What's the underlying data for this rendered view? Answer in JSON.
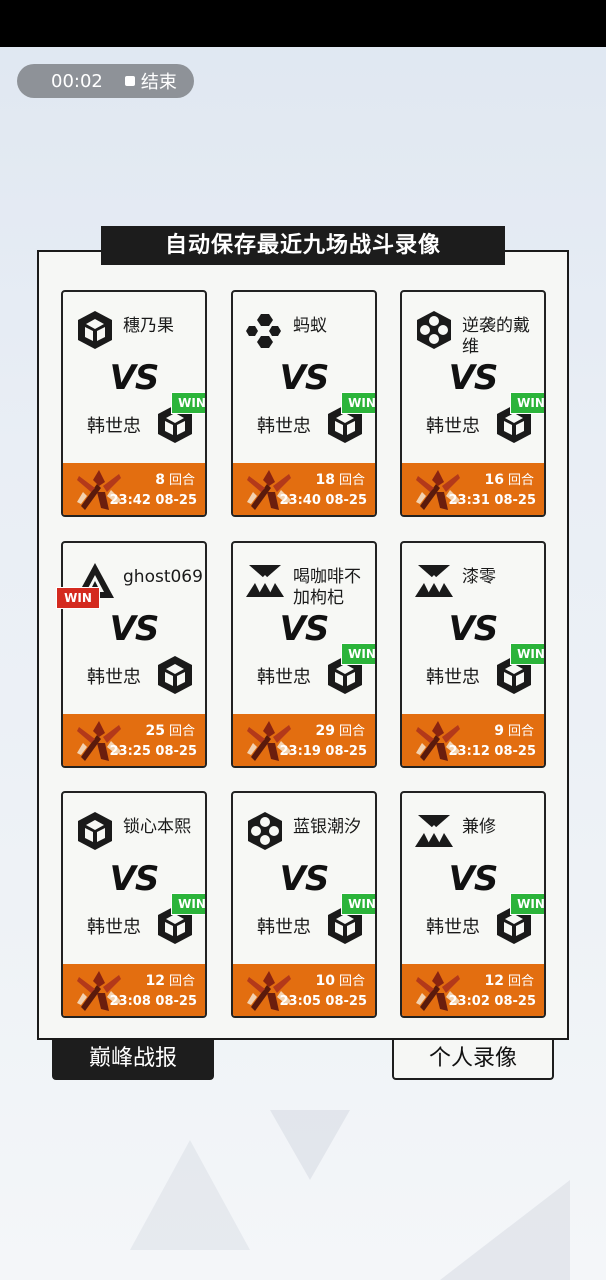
{
  "status_bar": {
    "timer": "00:02",
    "stop_label": "结束"
  },
  "panel": {
    "title": "自动保存最近九场战斗录像"
  },
  "me_name": "韩世忠",
  "vs_text": "VS",
  "win_label": "WIN",
  "rounds_unit": "回合",
  "cards": [
    {
      "opponent": "穗乃果",
      "opp_icon": "cube-icon",
      "rounds": "8",
      "time": "23:42 08-25",
      "winner": "me"
    },
    {
      "opponent": "蚂蚁",
      "opp_icon": "hexagon-dots-icon",
      "rounds": "18",
      "time": "23:40 08-25",
      "winner": "me"
    },
    {
      "opponent": "逆袭的戴维",
      "opp_icon": "hexagon-cluster-icon",
      "rounds": "16",
      "time": "23:31 08-25",
      "winner": "me"
    },
    {
      "opponent": "ghost069",
      "opp_icon": "triangle-icon",
      "rounds": "25",
      "time": "23:25 08-25",
      "winner": "opponent"
    },
    {
      "opponent": "喝咖啡不加枸杞",
      "opp_icon": "triforce-icon",
      "rounds": "29",
      "time": "23:19 08-25",
      "winner": "me"
    },
    {
      "opponent": "漆零",
      "opp_icon": "triforce-icon",
      "rounds": "9",
      "time": "23:12 08-25",
      "winner": "me"
    },
    {
      "opponent": "锁心本熙",
      "opp_icon": "cube-icon",
      "rounds": "12",
      "time": "23:08 08-25",
      "winner": "me"
    },
    {
      "opponent": "蓝银潮汐",
      "opp_icon": "hexagon-cluster-icon",
      "rounds": "10",
      "time": "23:05 08-25",
      "winner": "me"
    },
    {
      "opponent": "兼修",
      "opp_icon": "triforce-icon",
      "rounds": "12",
      "time": "23:02 08-25",
      "winner": "me"
    }
  ],
  "tabs": {
    "left": "巅峰战报",
    "right": "个人录像"
  },
  "colors": {
    "footer_orange": "#e36e10",
    "win_green": "#2bb43a",
    "win_red": "#d42a1f",
    "panel_bg": "#f6f7f5"
  }
}
